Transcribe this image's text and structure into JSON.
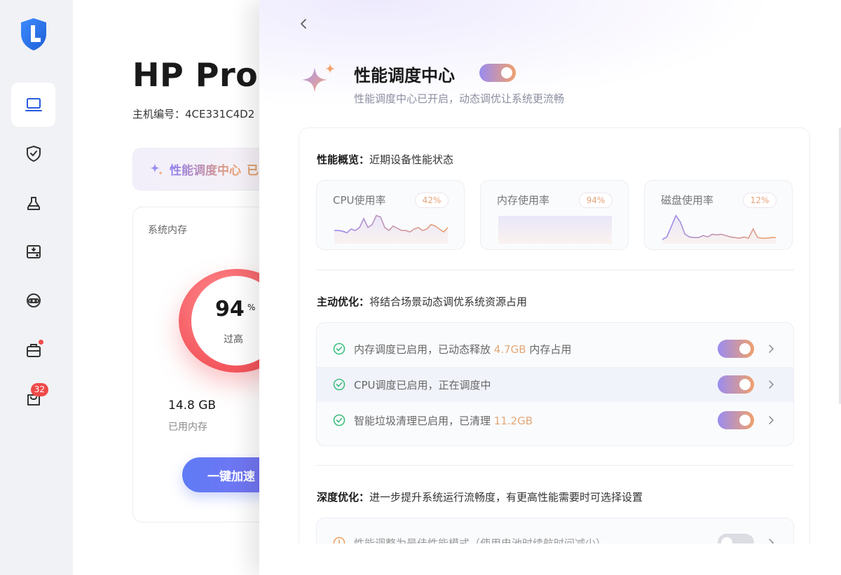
{
  "sidebar": {
    "logo_icon": "logo-shield-l",
    "items": [
      {
        "name": "device",
        "icon": "laptop-icon",
        "active": true
      },
      {
        "name": "security",
        "icon": "shield-check-icon"
      },
      {
        "name": "cleanup",
        "icon": "broom-icon"
      },
      {
        "name": "drive",
        "icon": "drive-icon"
      },
      {
        "name": "support",
        "icon": "headset-icon"
      },
      {
        "name": "toolbox",
        "icon": "toolbox-icon",
        "dot": true
      },
      {
        "name": "store",
        "icon": "bag-icon",
        "badge": "32"
      }
    ]
  },
  "device": {
    "title": "HP Pro",
    "serial": "主机编号：4CE331C4D2"
  },
  "banner": {
    "label": "性能调度中心",
    "tail": "已"
  },
  "memory": {
    "label": "系统内存",
    "percent": "94",
    "percent_unit": "%",
    "status": "过高",
    "used_value": "14.8 GB",
    "used_label": "已用内存",
    "boost_button": "一键加速"
  },
  "panel": {
    "title": "性能调度中心",
    "enabled": true,
    "subtitle": "性能调度中心已开启，动态调优让系统更流畅",
    "overview": {
      "heading": "性能概览：",
      "desc": "近期设备性能状态",
      "metrics": [
        {
          "label": "CPU使用率",
          "value": "42%",
          "series": [
            14,
            14,
            13,
            11,
            16,
            14,
            18,
            30,
            18,
            22,
            34,
            32,
            18,
            14,
            20,
            17,
            14,
            14,
            12,
            16,
            18,
            14,
            16,
            22,
            20,
            16,
            12,
            18
          ]
        },
        {
          "label": "内存使用率",
          "value": "94%",
          "series": [
            94,
            94,
            94,
            94,
            94,
            94,
            94,
            94,
            94,
            94,
            94,
            94,
            94,
            94,
            94,
            94,
            94,
            94,
            94,
            94
          ]
        },
        {
          "label": "磁盘使用率",
          "value": "12%",
          "series": [
            2,
            6,
            22,
            38,
            28,
            10,
            6,
            5,
            5,
            8,
            6,
            10,
            9,
            10,
            8,
            6,
            5,
            4,
            6,
            4,
            18,
            5,
            4,
            4,
            5,
            5
          ]
        }
      ]
    },
    "active": {
      "heading": "主动优化：",
      "desc": "将结合场景动态调优系统资源占用",
      "items": [
        {
          "pre": "内存调度已启用，已动态释放 ",
          "acc": "4.7GB",
          "post": " 内存占用",
          "enabled": true
        },
        {
          "pre": "CPU调度已启用，正在调度中",
          "acc": "",
          "post": "",
          "enabled": true
        },
        {
          "pre": "智能垃圾清理已启用，已清理 ",
          "acc": "11.2GB",
          "post": "",
          "enabled": true
        }
      ]
    },
    "deep": {
      "heading": "深度优化：",
      "desc": "进一步提升系统运行流畅度，有更高性能需要时可选择设置",
      "item": "性能调整为最佳性能模式（使用电池时续航时间减少）",
      "enabled": false
    }
  },
  "colors": {
    "accent_purple": "#9a8cf0",
    "accent_orange": "#f0a06c",
    "gauge_red": "#f4575e",
    "success_green": "#3fbf7f",
    "warn_orange": "#f0a060"
  }
}
